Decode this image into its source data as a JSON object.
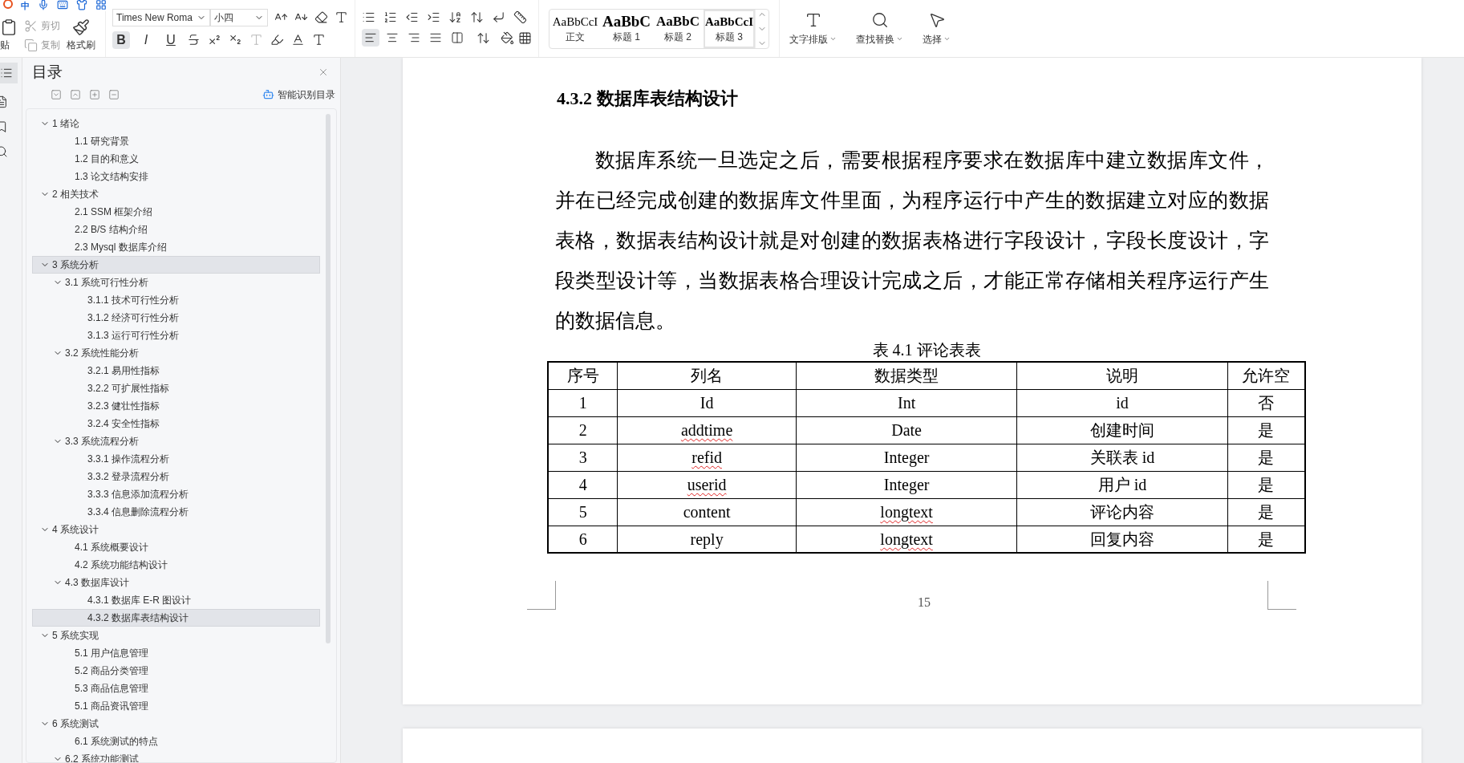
{
  "ime_bar": {
    "mode": "中"
  },
  "toolbar": {
    "clipboard": {
      "paste": "贴",
      "cut": "剪切",
      "copy": "复制",
      "format_painter": "格式刷"
    },
    "font": {
      "family": "Times New Roma",
      "size": "小四"
    },
    "format_buttons": [
      {
        "label": "B",
        "selected": true
      },
      {
        "label": "I",
        "selected": false
      },
      {
        "label": "U",
        "selected": false
      }
    ],
    "align_buttons": [
      {
        "kind": "left",
        "selected": true
      },
      {
        "kind": "center",
        "selected": false
      },
      {
        "kind": "right",
        "selected": false
      },
      {
        "kind": "justify",
        "selected": false
      },
      {
        "kind": "distribute",
        "selected": false
      }
    ],
    "styles": [
      {
        "sample": "AaBbCcI",
        "label": "正文",
        "kind": "normal",
        "selected": false
      },
      {
        "sample": "AaBbC",
        "label": "标题 1",
        "kind": "h1",
        "selected": false
      },
      {
        "sample": "AaBbC",
        "label": "标题 2",
        "kind": "h2",
        "selected": false
      },
      {
        "sample": "AaBbCcI",
        "label": "标题 3",
        "kind": "h3",
        "selected": true
      }
    ],
    "actions": [
      {
        "label": "文字排版",
        "kind": "layout"
      },
      {
        "label": "查找替换",
        "kind": "find"
      },
      {
        "label": "选择",
        "kind": "select"
      }
    ]
  },
  "sidebar": {
    "title": "目录",
    "smart_button": "智能识别目录",
    "items": [
      {
        "label": "1  绪论",
        "expanded": true,
        "selected": false,
        "children": [
          {
            "label": "1.1  研究背景",
            "selected": false
          },
          {
            "label": "1.2  目的和意义",
            "selected": false
          },
          {
            "label": "1.3  论文结构安排",
            "selected": false
          }
        ]
      },
      {
        "label": "2  相关技术",
        "expanded": true,
        "selected": false,
        "children": [
          {
            "label": "2.1 SSM 框架介绍",
            "selected": false
          },
          {
            "label": "2.2 B/S 结构介绍",
            "selected": false
          },
          {
            "label": "2.3 Mysql 数据库介绍",
            "selected": false
          }
        ]
      },
      {
        "label": "3  系统分析",
        "expanded": true,
        "selected": true,
        "children": [
          {
            "label": "3.1  系统可行性分析",
            "expanded": true,
            "selected": false,
            "children": [
              {
                "label": "3.1.1  技术可行性分析",
                "selected": false
              },
              {
                "label": "3.1.2  经济可行性分析",
                "selected": false
              },
              {
                "label": "3.1.3  运行可行性分析",
                "selected": false
              }
            ]
          },
          {
            "label": "3.2  系统性能分析",
            "expanded": true,
            "selected": false,
            "children": [
              {
                "label": "3.2.1  易用性指标",
                "selected": false
              },
              {
                "label": "3.2.2  可扩展性指标",
                "selected": false
              },
              {
                "label": "3.2.3  健壮性指标",
                "selected": false
              },
              {
                "label": "3.2.4  安全性指标",
                "selected": false
              }
            ]
          },
          {
            "label": "3.3  系统流程分析",
            "expanded": true,
            "selected": false,
            "children": [
              {
                "label": "3.3.1  操作流程分析",
                "selected": false
              },
              {
                "label": "3.3.2  登录流程分析",
                "selected": false
              },
              {
                "label": "3.3.3  信息添加流程分析",
                "selected": false
              },
              {
                "label": "3.3.4  信息删除流程分析",
                "selected": false
              }
            ]
          }
        ]
      },
      {
        "label": "4  系统设计",
        "expanded": true,
        "selected": false,
        "children": [
          {
            "label": "4.1  系统概要设计",
            "selected": false
          },
          {
            "label": "4.2  系统功能结构设计",
            "selected": false
          },
          {
            "label": "4.3  数据库设计",
            "expanded": true,
            "selected": false,
            "children": [
              {
                "label": "4.3.1  数据库 E-R 图设计",
                "selected": false
              },
              {
                "label": "4.3.2  数据库表结构设计",
                "selected": true
              }
            ]
          }
        ]
      },
      {
        "label": "5  系统实现",
        "expanded": true,
        "selected": false,
        "children": [
          {
            "label": "5.1 用户信息管理",
            "selected": false
          },
          {
            "label": "5.2  商品分类管理",
            "selected": false
          },
          {
            "label": "5.3 商品信息管理",
            "selected": false
          },
          {
            "label": "5.1 商品资讯管理",
            "selected": false
          }
        ]
      },
      {
        "label": "6  系统测试",
        "expanded": true,
        "selected": false,
        "children": [
          {
            "label": "6.1  系统测试的特点",
            "selected": false
          },
          {
            "label": "6.2  系统功能测试",
            "expanded": true,
            "selected": false
          }
        ]
      }
    ]
  },
  "document": {
    "heading": "4.3.2  数据库表结构设计",
    "paragraph": "数据库系统一旦选定之后，需要根据程序要求在数据库中建立数据库文件，并在已经完成创建的数据库文件里面，为程序运行中产生的数据建立对应的数据表格，数据表结构设计就是对创建的数据表格进行字段设计，字段长度设计，字段类型设计等，当数据表格合理设计完成之后，才能正常存储相关程序运行产生的数据信息。",
    "table": {
      "caption": "表 4.1 评论表表",
      "columns": [
        "序号",
        "列名",
        "数据类型",
        "说明",
        "允许空"
      ],
      "rows": [
        [
          {
            "text": "1",
            "misspelled": false
          },
          {
            "text": "Id",
            "misspelled": false
          },
          {
            "text": "Int",
            "misspelled": false
          },
          {
            "text": "id",
            "misspelled": false
          },
          {
            "text": "否",
            "misspelled": false
          }
        ],
        [
          {
            "text": "2",
            "misspelled": false
          },
          {
            "text": "addtime",
            "misspelled": true
          },
          {
            "text": "Date",
            "misspelled": false
          },
          {
            "text": "创建时间",
            "misspelled": false
          },
          {
            "text": "是",
            "misspelled": false
          }
        ],
        [
          {
            "text": "3",
            "misspelled": false
          },
          {
            "text": "refid",
            "misspelled": true
          },
          {
            "text": "Integer",
            "misspelled": false
          },
          {
            "text": "关联表 id",
            "misspelled": false
          },
          {
            "text": "是",
            "misspelled": false
          }
        ],
        [
          {
            "text": "4",
            "misspelled": false
          },
          {
            "text": "userid",
            "misspelled": true
          },
          {
            "text": "Integer",
            "misspelled": false
          },
          {
            "text": "用户 id",
            "misspelled": false
          },
          {
            "text": "是",
            "misspelled": false
          }
        ],
        [
          {
            "text": "5",
            "misspelled": false
          },
          {
            "text": "content",
            "misspelled": false
          },
          {
            "text": "longtext",
            "misspelled": true
          },
          {
            "text": "评论内容",
            "misspelled": false
          },
          {
            "text": "是",
            "misspelled": false
          }
        ],
        [
          {
            "text": "6",
            "misspelled": false
          },
          {
            "text": "reply",
            "misspelled": false
          },
          {
            "text": "longtext",
            "misspelled": true
          },
          {
            "text": "回复内容",
            "misspelled": false
          },
          {
            "text": "是",
            "misspelled": false
          }
        ]
      ]
    },
    "page_number": "15"
  }
}
